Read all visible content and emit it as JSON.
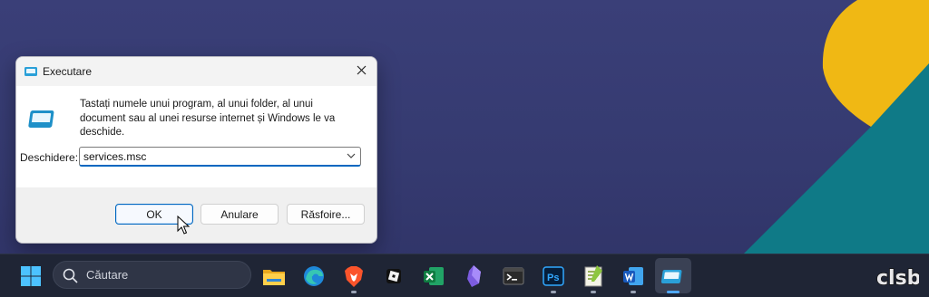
{
  "dialog": {
    "title": "Executare",
    "prompt": "Tastați numele unui program, al unui folder, al unui document sau al unei resurse internet și Windows le va deschide.",
    "open_label": "Deschidere:",
    "open_value": "services.msc",
    "buttons": {
      "ok": "OK",
      "cancel": "Anulare",
      "browse": "Răsfoire..."
    }
  },
  "taskbar": {
    "search_placeholder": "Căutare",
    "apps": [
      "start",
      "search",
      "file-explorer",
      "edge",
      "brave",
      "roblox",
      "excel",
      "obsidian",
      "terminal",
      "photoshop",
      "notepad++",
      "word",
      "run"
    ]
  },
  "watermark": "clsb",
  "colors": {
    "accent": "#0067c0",
    "taskbar": "#1f2535",
    "wallpaper": "#373c74",
    "yellow": "#f0b814",
    "teal": "#0f7a87"
  }
}
